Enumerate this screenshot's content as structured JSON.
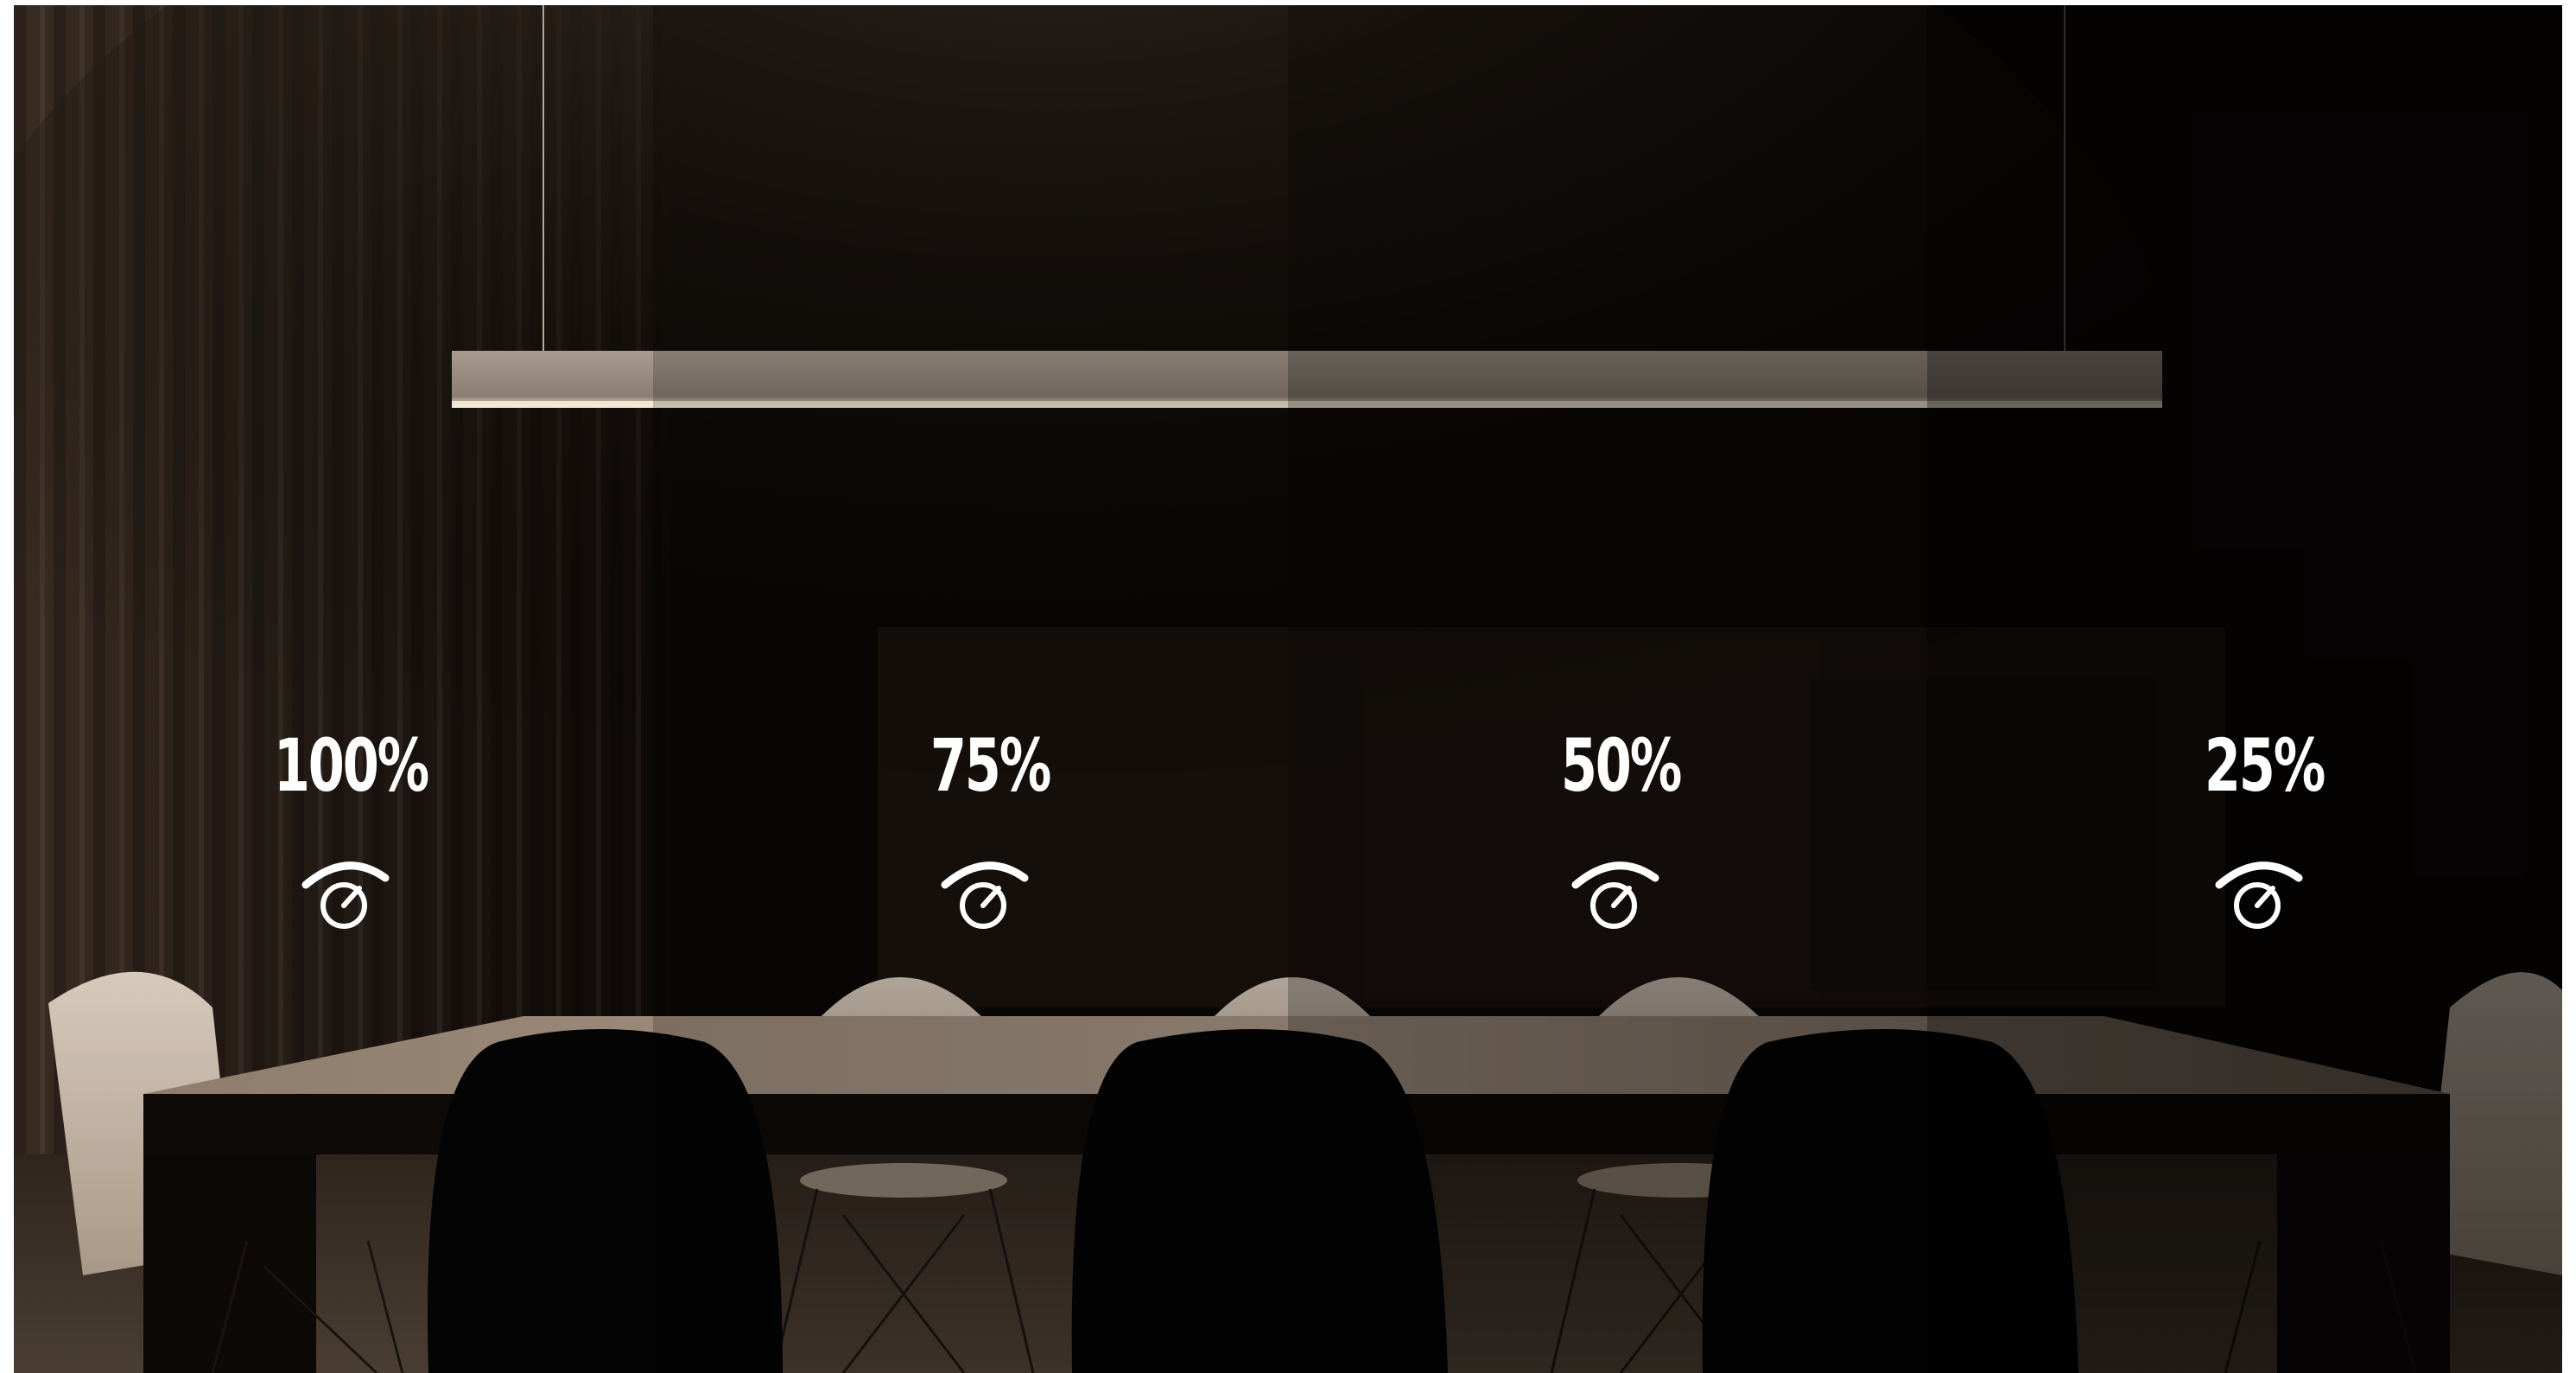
{
  "levels": [
    {
      "label": "100%",
      "value": 1.0,
      "icon": "dimmer-dial-icon"
    },
    {
      "label": "75%",
      "value": 0.75,
      "icon": "dimmer-dial-icon"
    },
    {
      "label": "50%",
      "value": 0.5,
      "icon": "dimmer-dial-icon"
    },
    {
      "label": "25%",
      "value": 0.25,
      "icon": "dimmer-dial-icon"
    }
  ],
  "colors": {
    "background": "#0a0705",
    "light": "#e8dcc8",
    "text": "#ffffff"
  }
}
